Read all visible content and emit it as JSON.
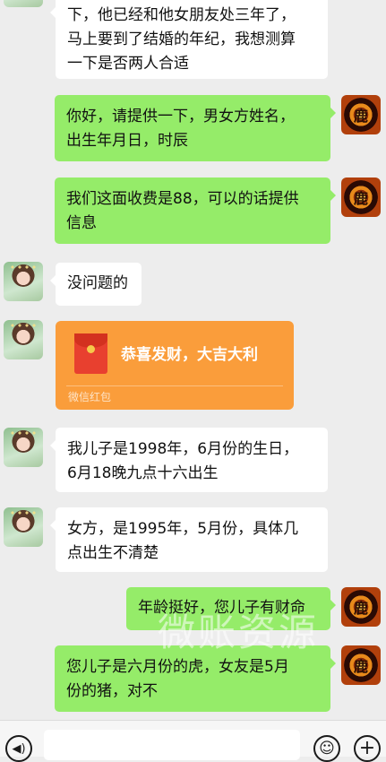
{
  "messages": [
    {
      "side": "in",
      "lines": [
        "下，他已经和他女朋友处三年了，",
        "马上要到了结婚的年纪，我想测算",
        "一下是否两人合适"
      ]
    },
    {
      "side": "out",
      "lines": [
        "你好，请提供一下，男女方姓名，",
        "出生年月日，时辰"
      ]
    },
    {
      "side": "out",
      "lines": [
        "我们这面收费是88，可以的话提供",
        "信息"
      ]
    },
    {
      "side": "in",
      "lines": [
        "没问题的"
      ]
    },
    {
      "side": "in",
      "type": "red_packet",
      "title": "恭喜发财，大吉大利",
      "label": "微信红包"
    },
    {
      "side": "in",
      "lines": [
        "我儿子是1998年，6月份的生日，",
        "6月18晚九点十六出生"
      ]
    },
    {
      "side": "in",
      "lines": [
        "女方，是1995年，5月份，具体几",
        "点出生不清楚"
      ]
    },
    {
      "side": "out",
      "lines": [
        "年龄挺好，您儿子有财命"
      ]
    },
    {
      "side": "out",
      "lines": [
        "您儿子是六月份的虎，女友是5月",
        "份的猪，对不"
      ]
    }
  ],
  "watermark": "微账资源",
  "avatar_glyph": "鹿",
  "input_bar": {
    "voice_icon": "voice-icon",
    "emoji_icon": "emoji-icon",
    "plus_icon": "plus-icon"
  },
  "colors": {
    "background": "#ededed",
    "out_bubble": "#95ec69",
    "in_bubble": "#ffffff",
    "red_packet": "#fa9d3b"
  }
}
